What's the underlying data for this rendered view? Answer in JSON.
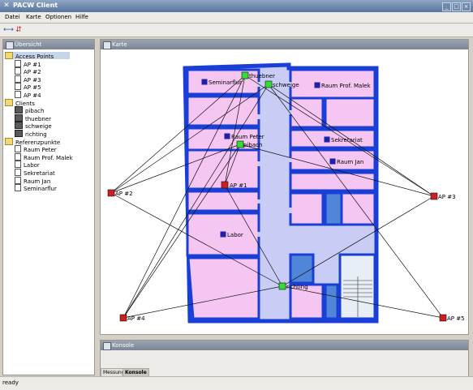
{
  "window": {
    "title": "PACW Client"
  },
  "menu": [
    "Datei",
    "Karte",
    "Optionen",
    "Hilfe"
  ],
  "left_panel": {
    "title": "Übersicht",
    "groups": [
      {
        "label": "Access Points",
        "items": [
          "AP #1",
          "AP #2",
          "AP #3",
          "AP #5",
          "AP #4"
        ]
      },
      {
        "label": "Clients",
        "items": [
          "pibach",
          "thuebner",
          "schweige",
          "richting"
        ]
      },
      {
        "label": "Referenzpunkte",
        "items": [
          "Raum Peter",
          "Raum Prof. Malek",
          "Labor",
          "Sekretariat",
          "Raum Jan",
          "Seminarflur"
        ]
      }
    ]
  },
  "map_panel": {
    "title": "Karte",
    "labels": {
      "seminarflur": "Seminarflur",
      "raum_prof_malek": "Raum Prof. Malek",
      "raum_peter": "Raum Peter",
      "sekretariat": "Sekretariat",
      "raum_jan": "Raum Jan",
      "labor": "Labor",
      "thuebner": "thuebner",
      "schweige": "schweige",
      "pibach": "pibach",
      "richting": "richting",
      "ap1": "AP #1",
      "ap2": "AP #2",
      "ap3": "AP #3",
      "ap4": "AP #4",
      "ap5": "AP #5"
    },
    "colors": {
      "wall": "#1a3fd6",
      "room": "#f6c6f2",
      "corridor": "#c9cdf5",
      "reference": "#2020a8",
      "client": "#33dd33",
      "access_point": "#cc2020"
    }
  },
  "console": {
    "title": "Konsole",
    "tabs": [
      "Messung",
      "Konsole"
    ],
    "active_tab": "Konsole"
  },
  "status": {
    "text": "ready"
  }
}
